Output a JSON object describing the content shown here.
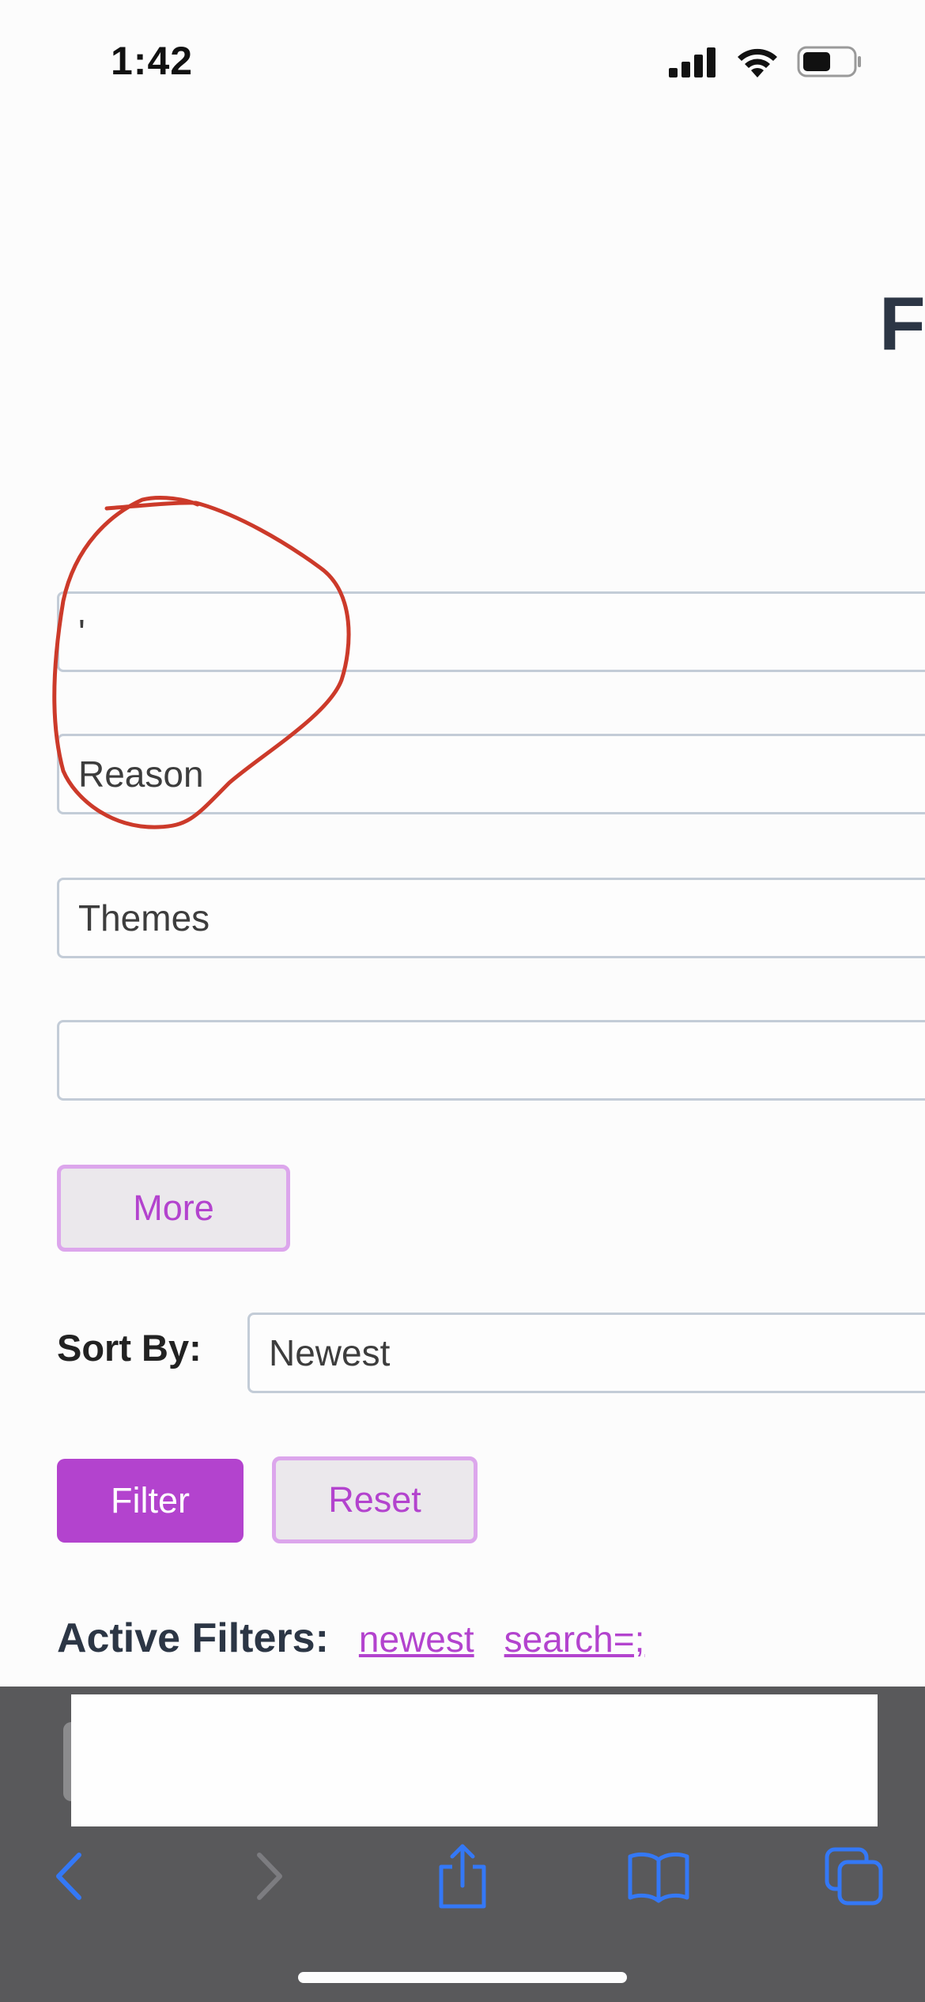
{
  "status_bar": {
    "time": "1:42"
  },
  "page": {
    "heading_partial": "F"
  },
  "form": {
    "field1_value": "'",
    "field2_value": "Reason",
    "field3_value": "Themes",
    "field4_value": "",
    "more_label": "More",
    "sort_label": "Sort By:",
    "sort_value": "Newest",
    "filter_label": "Filter",
    "reset_label": "Reset"
  },
  "active_filters": {
    "label": "Active Filters:",
    "items": [
      "newest",
      "search=;"
    ]
  },
  "colors": {
    "accent": "#b343ce",
    "accent_border": "#dca6ec",
    "annotation": "#cc3a2a",
    "toolbar_icons": "#3478f6",
    "bottom_bar": "#59595b"
  },
  "icons": {
    "status": [
      "cellular-signal-icon",
      "wifi-icon",
      "battery-icon"
    ],
    "toolbar": [
      "back-icon",
      "forward-icon",
      "share-icon",
      "bookmarks-icon",
      "tabs-icon"
    ]
  }
}
